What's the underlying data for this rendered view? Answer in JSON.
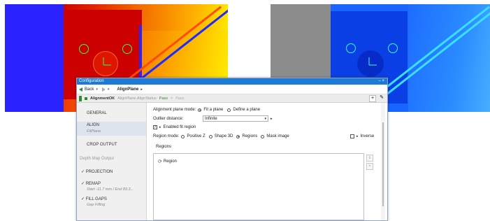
{
  "window": {
    "title": "Configuration",
    "controls": "– ×"
  },
  "toolbar": {
    "back_label": "Back",
    "breadcrumb": "AlignPlane"
  },
  "status": {
    "ok_label": "AlignmentOK",
    "path": "AlignPlane.AlignStatus",
    "result": "Pass",
    "result2": "Pass",
    "sep": "="
  },
  "sidebar": {
    "items": [
      {
        "label": "GENERAL"
      },
      {
        "label": "ALIGN",
        "sub": "FitPlane"
      },
      {
        "label": "CROP OUTPUT"
      },
      {
        "label": "Depth Map Output"
      },
      {
        "label": "PROJECTION",
        "check": "✓"
      },
      {
        "label": "REMAP",
        "check": "✓",
        "sub": "Start -11.7 mm / End 83.3..."
      },
      {
        "label": "FILL GAPS",
        "check": "✓",
        "sub": "Gap Filling"
      }
    ]
  },
  "align": {
    "mode_label": "Alignment plane mode:",
    "mode_options": [
      "Fit a plane",
      "Define a plane"
    ],
    "outlier_label": "Outlier distance:",
    "outlier_value": "Infinite",
    "enabled_fit_label": "Enabled fit region",
    "region_mode_label": "Region mode:",
    "region_options": [
      "Positive Z",
      "Shape 3D",
      "Regions",
      "Mask image"
    ],
    "inverse_label": "Inverse",
    "regions_header": "Regions",
    "region_item": "Region"
  },
  "colors": {
    "title_bar": "#1e79d4",
    "accent_green": "#2e8b2e",
    "heat_red": "#d80000",
    "heat_blue": "#2a22ff",
    "blue_map": "#1866ff"
  }
}
